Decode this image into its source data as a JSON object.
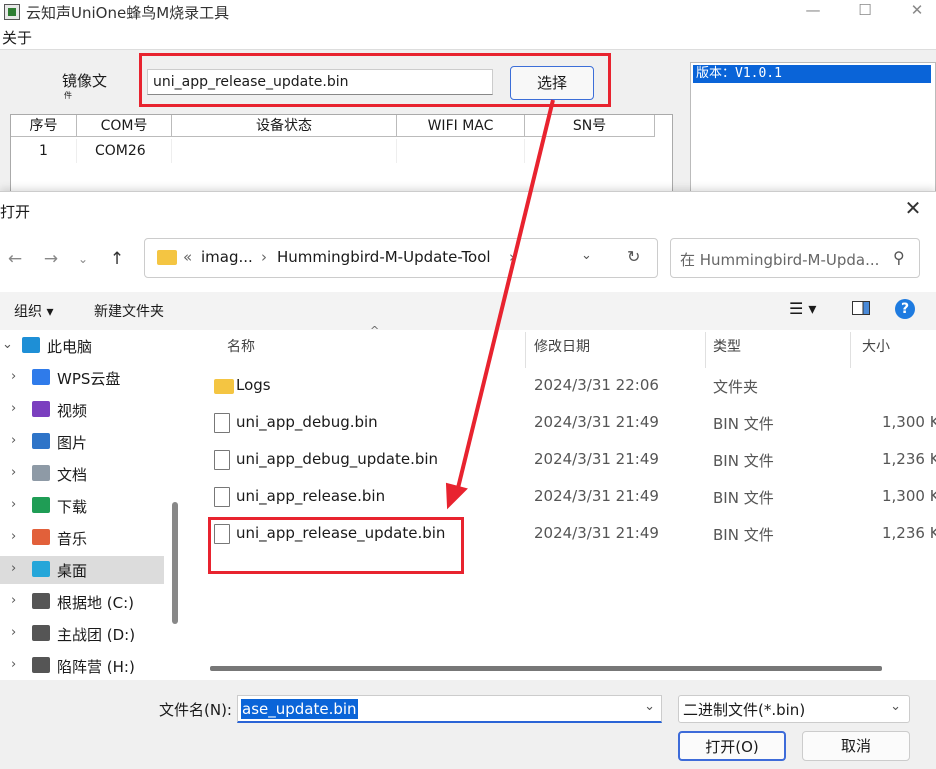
{
  "app": {
    "title": "云知声UniOne蜂鸟M烧录工具",
    "menu_about": "关于",
    "image_label": "镜像文",
    "image_label_cut": "件",
    "image_path": "uni_app_release_update.bin",
    "select_button": "选择",
    "table_headers": [
      "序号",
      "COM号",
      "设备状态",
      "WIFI MAC",
      "SN号"
    ],
    "table_rows": [
      {
        "index": "1",
        "com": "COM26"
      }
    ],
    "version_text": "版本：V1.0.1"
  },
  "dialog": {
    "title": "打开",
    "address": {
      "overflow": "«",
      "crumb1": "imag...",
      "sep": "›",
      "crumb2": "Hummingbird-M-Update-Tool",
      "sep2": "›"
    },
    "search_placeholder": "在 Hummingbird-M-Upda...",
    "toolbar": {
      "organize": "组织 ▾",
      "new_folder": "新建文件夹"
    },
    "nav_items": [
      {
        "label": "此电脑",
        "icon": "computer-icon",
        "color": "#1e8fd6",
        "expanded": true
      },
      {
        "label": "WPS云盘",
        "icon": "cloud-icon",
        "color": "#2f7bea"
      },
      {
        "label": "视频",
        "icon": "video-icon",
        "color": "#7b3fbf"
      },
      {
        "label": "图片",
        "icon": "pictures-icon",
        "color": "#2e74c8"
      },
      {
        "label": "文档",
        "icon": "documents-icon",
        "color": "#8e9aa6"
      },
      {
        "label": "下载",
        "icon": "download-icon",
        "color": "#1f9d55"
      },
      {
        "label": "音乐",
        "icon": "music-icon",
        "color": "#e2603a"
      },
      {
        "label": "桌面",
        "icon": "desktop-icon",
        "color": "#25a6d9",
        "active": true
      },
      {
        "label": "根据地 (C:)",
        "icon": "drive-c-icon",
        "color": "#555555"
      },
      {
        "label": "主战团 (D:)",
        "icon": "drive-d-icon",
        "color": "#555555"
      },
      {
        "label": "陷阵营 (H:)",
        "icon": "drive-h-icon",
        "color": "#555555"
      }
    ],
    "columns": {
      "name": "名称",
      "date": "修改日期",
      "type": "类型",
      "size": "大小"
    },
    "files": [
      {
        "name": "Logs",
        "date": "2024/3/31 22:06",
        "type": "文件夹",
        "size": "",
        "folder": true
      },
      {
        "name": "uni_app_debug.bin",
        "date": "2024/3/31 21:49",
        "type": "BIN 文件",
        "size": "1,300 K"
      },
      {
        "name": "uni_app_debug_update.bin",
        "date": "2024/3/31 21:49",
        "type": "BIN 文件",
        "size": "1,236 K"
      },
      {
        "name": "uni_app_release.bin",
        "date": "2024/3/31 21:49",
        "type": "BIN 文件",
        "size": "1,300 K"
      },
      {
        "name": "uni_app_release_update.bin",
        "date": "2024/3/31 21:49",
        "type": "BIN 文件",
        "size": "1,236 K"
      }
    ],
    "filename_label": "文件名(N):",
    "filename_value": "ase_update.bin",
    "filetype_value": "二进制文件(*.bin)",
    "open_button": "打开(O)",
    "cancel_button": "取消"
  },
  "colors": {
    "annotation_red": "#e8232f",
    "selection_blue": "#0a64d8",
    "accent_blue": "#0078d4"
  }
}
